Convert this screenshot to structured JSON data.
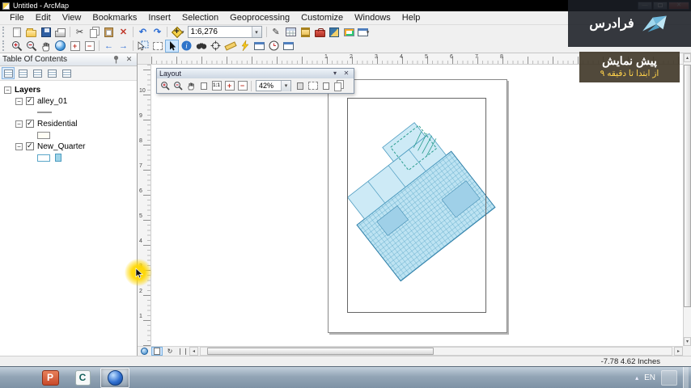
{
  "titlebar": {
    "title": "Untitled - ArcMap"
  },
  "menubar": {
    "items": [
      "File",
      "Edit",
      "View",
      "Bookmarks",
      "Insert",
      "Selection",
      "Geoprocessing",
      "Customize",
      "Windows",
      "Help"
    ]
  },
  "standard_toolbar": {
    "scale_value": "1:6,276"
  },
  "layout_window": {
    "title": "Layout",
    "zoom_value": "42%"
  },
  "toc": {
    "title": "Table Of Contents",
    "root_label": "Layers",
    "layers": [
      {
        "name": "alley_01",
        "checked": true,
        "symbol": "gray-line"
      },
      {
        "name": "Residential",
        "checked": true,
        "symbol": "outline-polygon"
      },
      {
        "name": "New_Quarter",
        "checked": true,
        "symbol": "blue-polygon"
      }
    ]
  },
  "rulers": {
    "horizontal": [
      "1",
      "2",
      "3",
      "4",
      "5",
      "6",
      "7",
      "8"
    ],
    "vertical": [
      "10",
      "9",
      "8",
      "7",
      "6",
      "5",
      "4",
      "3",
      "2",
      "1"
    ]
  },
  "statusbar": {
    "coordinates": "-7.78  4.62 Inches"
  },
  "taskbar": {
    "language": "EN"
  },
  "watermark": {
    "brand": "فرادرس",
    "line1": "پیش نمایش",
    "line2": "از ابتدا تا دقیقه ۹"
  },
  "colors": {
    "map_fill": "#bde3f2",
    "map_stroke": "#2e7fa8",
    "watermark_accent": "#ffd24a",
    "titlebar": "#000000"
  }
}
